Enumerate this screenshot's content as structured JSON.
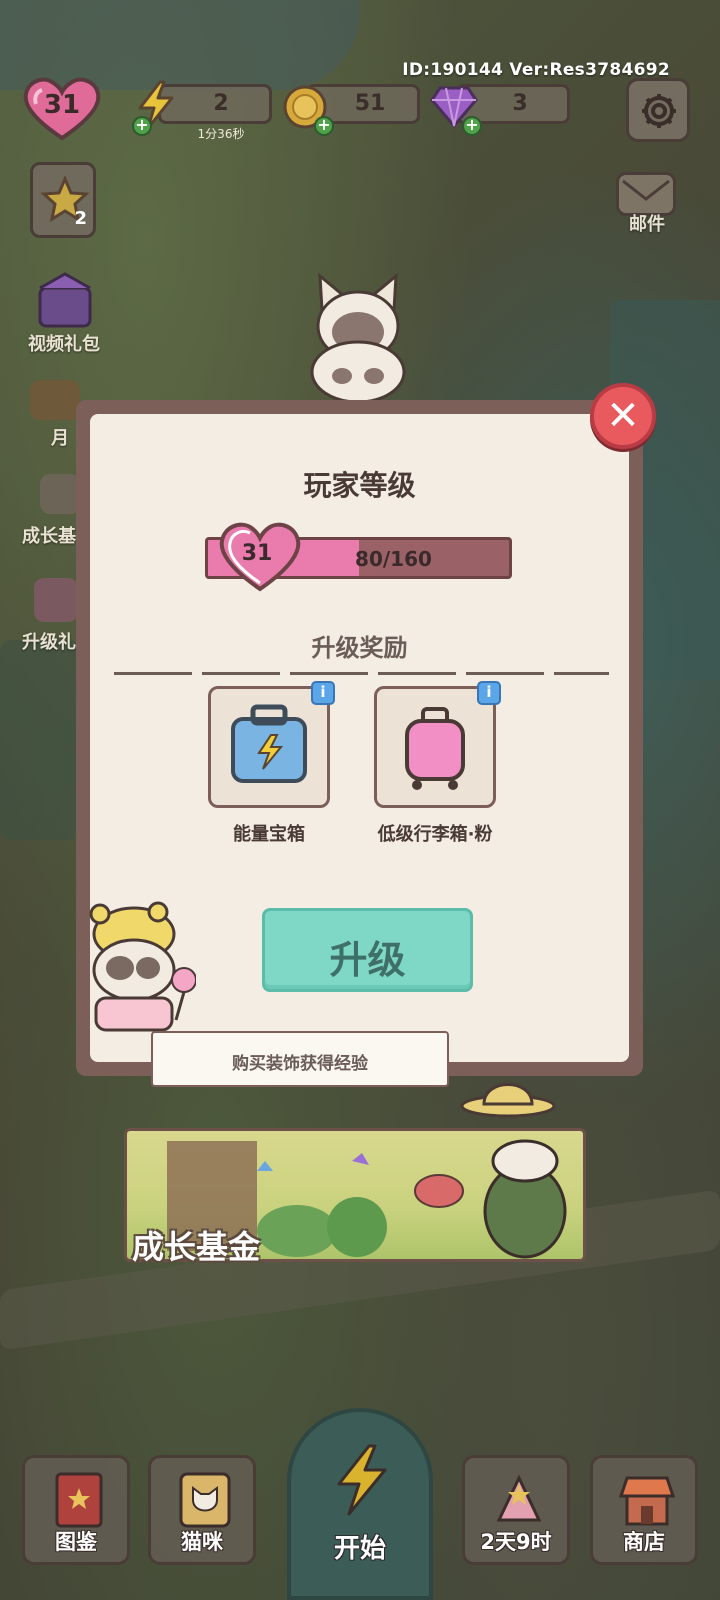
{
  "hud": {
    "id_text": "ID:190144  Ver:Res3784692",
    "level": "31",
    "energy": {
      "value": "2",
      "timer": "1分36秒"
    },
    "coins": {
      "value": "51"
    },
    "gems": {
      "value": "3"
    },
    "icons": [
      "lightning-icon",
      "coin-icon",
      "gem-icon",
      "gear-icon"
    ]
  },
  "side_menu": {
    "task_badge": "2",
    "video_gift": "视频礼包",
    "monthly_partial": "月",
    "growth_partial": "成长基",
    "levelup_partial": "升级礼",
    "mail": "邮件"
  },
  "dialog": {
    "title": "玩家等级",
    "level": "31",
    "xp_text": "80/160",
    "xp_current": 80,
    "xp_max": 160,
    "rewards_title": "升级奖励",
    "rewards": [
      {
        "label": "能量宝箱",
        "icon": "energy-chest-icon"
      },
      {
        "label": "低级行李箱·粉",
        "icon": "pink-suitcase-icon"
      }
    ],
    "info_glyph": "i",
    "upgrade_label": "升级",
    "tip": "购买装饰获得经验",
    "close_glyph": "✕"
  },
  "banner": {
    "title": "成长基金"
  },
  "bottom_nav": {
    "handbook": "图鉴",
    "cats": "猫咪",
    "start": "开始",
    "event": "2天9时",
    "shop": "商店"
  },
  "colors": {
    "dialog_border": "#7d5f59",
    "dialog_bg": "#f3ede4",
    "xp_fill": "#e97bad",
    "upgrade_button": "#7fd8c6",
    "close_button": "#e85a5e"
  }
}
